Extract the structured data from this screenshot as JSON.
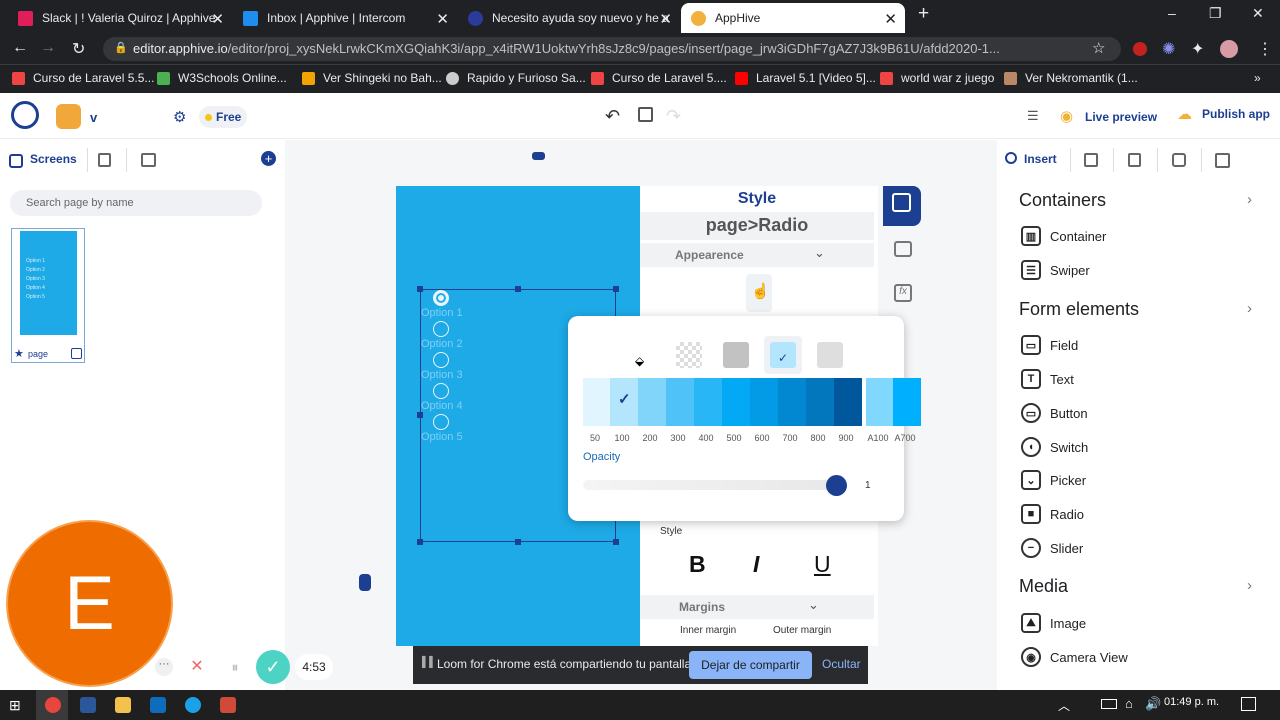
{
  "browser": {
    "tabs": [
      {
        "title": "Slack | ! Valeria Quiroz | Apphive"
      },
      {
        "title": "Inbox | Apphive | Intercom"
      },
      {
        "title": "Necesito ayuda soy nuevo y he a"
      },
      {
        "title": "AppHive"
      }
    ],
    "url_host": "editor.apphive.io",
    "url_path": "/editor/proj_xysNekLrwkCKmXGQiahK3i/app_x4itRW1UoktwYrh8sJz8c9/pages/insert/page_jrw3iGDhF7gAZ7J3k9B61U/afdd2020-1...",
    "bookmarks": [
      "Curso de Laravel 5.5...",
      "W3Schools Online...",
      "Ver Shingeki no Bah...",
      "Rapido y Furioso Sa...",
      "Curso de Laravel 5....",
      "Laravel 5.1 [Video 5]...",
      "world war z juego",
      "Ver Nekromantik (1..."
    ]
  },
  "header": {
    "project_initial": "v",
    "plan_badge": "Free",
    "live_preview": "Live preview",
    "publish": "Publish app"
  },
  "left": {
    "screens_label": "Screens",
    "search_placeholder": "Search page by name",
    "page_label": "page",
    "thumb_options": [
      "Option 1",
      "Option 2",
      "Option 3",
      "Option 4",
      "Option 5"
    ]
  },
  "canvas": {
    "options": [
      "Option 1",
      "Option 2",
      "Option 3",
      "Option 4",
      "Option 5"
    ]
  },
  "style_panel": {
    "title": "Style",
    "subtitle": "page>Radio",
    "appearance": "Appearence",
    "style_label": "Style",
    "bold": "B",
    "italic": "I",
    "underline": "U",
    "margins": "Margins",
    "inner_margin": "Inner margin",
    "outer_margin": "Outer margin"
  },
  "color_picker": {
    "shades": [
      "50",
      "100",
      "200",
      "300",
      "400",
      "500",
      "600",
      "700",
      "800",
      "900",
      "A100",
      "A700"
    ],
    "shade_colors": [
      "#e1f5fe",
      "#b3e5fc",
      "#81d4fa",
      "#4fc3f7",
      "#29b6f6",
      "#03a9f4",
      "#039be5",
      "#0288d1",
      "#0277bd",
      "#01579b",
      "#80d8ff",
      "#00b0ff"
    ],
    "selected_shade": "100",
    "opacity_label": "Opacity",
    "opacity_value": "1",
    "opacity": 1
  },
  "right": {
    "insert_tab": "Insert",
    "categories": {
      "containers": "Containers",
      "form_elements": "Form elements",
      "media": "Media"
    },
    "container_items": [
      "Container",
      "Swiper"
    ],
    "form_items": [
      "Field",
      "Text",
      "Button",
      "Switch",
      "Picker",
      "Radio",
      "Slider"
    ],
    "media_items": [
      "Image",
      "Camera View"
    ]
  },
  "recorder": {
    "avatar_letter": "E",
    "timer": "4:53"
  },
  "loom_bar": {
    "message": "Loom for Chrome está compartiendo tu pantalla.",
    "stop_button": "Dejar de compartir",
    "hide_button": "Ocultar"
  },
  "taskbar": {
    "time": "01:49 p. m."
  }
}
